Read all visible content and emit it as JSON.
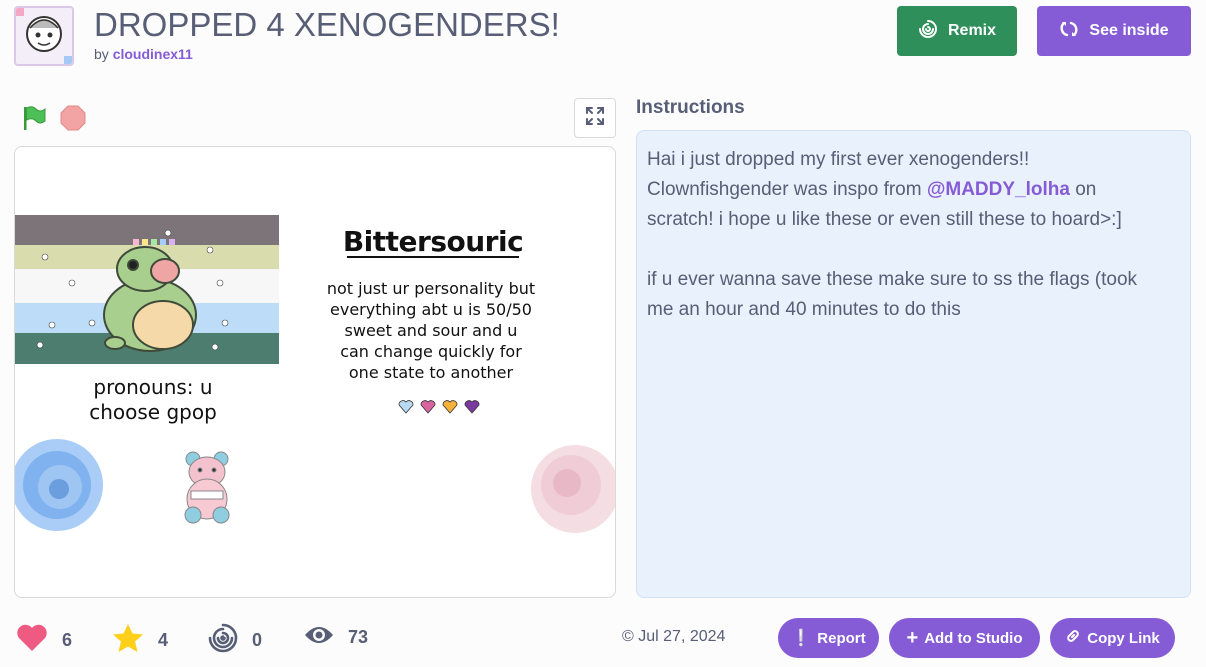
{
  "project": {
    "title": "DROPPED 4 XENOGENDERS!",
    "by_prefix": "by",
    "author": "cloudinex11"
  },
  "buttons": {
    "remix": "Remix",
    "see_inside": "See inside"
  },
  "stage": {
    "heading": "Bittersouric",
    "description_lines": [
      "not just ur personality but",
      "everything abt u is 50/50",
      "sweet and sour  and u",
      "can change quickly for",
      "one state to another"
    ],
    "pronoun_lines": [
      "pronouns: u",
      "choose gpop"
    ],
    "flag_colors": [
      "#7d7479",
      "#d9dcac",
      "#f7f7f7",
      "#bcdcf7",
      "#4d7d6e"
    ]
  },
  "instructions": {
    "title": "Instructions",
    "line1": "Hai i just dropped my first ever xenogenders!!",
    "line2_before": "Clownfishgender was inspo from ",
    "mention": "@MADDY_lolha",
    "line2_after": " on",
    "line3": "scratch! i hope u like these or even still these to hoard>:]",
    "line4": "if u ever wanna save these make sure to ss the flags (took",
    "line5": "me an hour and 40 minutes to do this"
  },
  "stats": {
    "loves": "6",
    "favorites": "4",
    "remixes": "0",
    "views": "73"
  },
  "date": "Jul 27, 2024",
  "actions": {
    "report": "Report",
    "add_to_studio": "Add to Studio",
    "copy_link": "Copy Link"
  },
  "colors": {
    "accent": "#855cd6",
    "remix": "#2f8f5a",
    "instructions_bg": "#e9f1fc",
    "love": "#ef5a82",
    "favorite": "#ffcf1a"
  },
  "icons": [
    "remix-icon",
    "see-inside-icon",
    "green-flag-icon",
    "stop-icon",
    "fullscreen-icon",
    "heart-icon",
    "star-icon",
    "remix-count-icon",
    "eye-icon",
    "report-icon",
    "plus-icon",
    "link-icon",
    "copyright-icon"
  ]
}
